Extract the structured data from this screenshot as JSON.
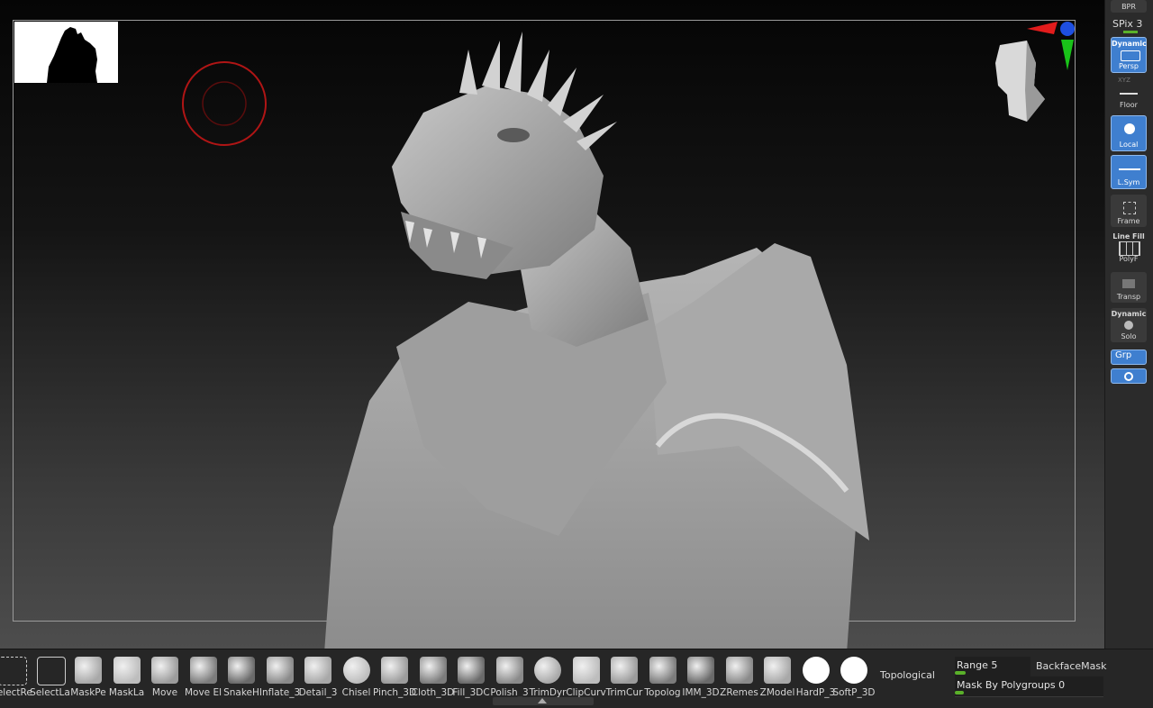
{
  "shelf": {
    "bpr": "BPR",
    "spix": "SPix 3",
    "dynamic": "Dynamic",
    "persp": "Persp",
    "xyz": "XYZ",
    "floor": "Floor",
    "local": "Local",
    "lsym": "L.Sym",
    "frame": "Frame",
    "linefill": "Line Fill",
    "polyf": "PolyF",
    "transp": "Transp",
    "dynamic2": "Dynamic",
    "solo": "Solo",
    "grp": "Grp"
  },
  "brushes": [
    {
      "name": "SelectRe",
      "icon": "select-rect-icon"
    },
    {
      "name": "SelectLa",
      "icon": "select-lasso-icon"
    },
    {
      "name": "MaskPe",
      "icon": "mask-pen-icon"
    },
    {
      "name": "MaskLa",
      "icon": "mask-lasso-icon"
    },
    {
      "name": "Move",
      "icon": "move-brush-icon"
    },
    {
      "name": "Move El",
      "icon": "move-elastic-icon"
    },
    {
      "name": "SnakeH",
      "icon": "snake-hook-icon"
    },
    {
      "name": "Inflate_3",
      "icon": "inflate-icon"
    },
    {
      "name": "Detail_3",
      "icon": "detail-icon"
    },
    {
      "name": "Chisel",
      "icon": "chisel-icon"
    },
    {
      "name": "Pinch_3D",
      "icon": "pinch-icon"
    },
    {
      "name": "Cloth_3D",
      "icon": "cloth-icon"
    },
    {
      "name": "Fill_3DC",
      "icon": "fill-icon"
    },
    {
      "name": "Polish_3",
      "icon": "polish-icon"
    },
    {
      "name": "TrimDyr",
      "icon": "trim-dynamic-icon"
    },
    {
      "name": "ClipCurv",
      "icon": "clip-curve-icon"
    },
    {
      "name": "TrimCur",
      "icon": "trim-curve-icon"
    },
    {
      "name": "Topolog",
      "icon": "topology-icon"
    },
    {
      "name": "IMM_3D",
      "icon": "imm-icon"
    },
    {
      "name": "ZRemes",
      "icon": "zremesh-icon"
    },
    {
      "name": "ZModel",
      "icon": "zmodeler-icon"
    },
    {
      "name": "HardP_3",
      "icon": "hard-polish-icon"
    },
    {
      "name": "SoftP_3D",
      "icon": "soft-polish-icon"
    }
  ],
  "tray": {
    "topological": "Topological",
    "range_label": "Range 5",
    "range_value": 0.1,
    "backface": "BackfaceMask",
    "mask_polygroups": "Mask By Polygroups 0",
    "mask_polygroups_value": 0
  },
  "colors": {
    "accent_blue": "#3f7fcf",
    "slider_green": "#5ab02a",
    "gizmo_red": "#e21c1c",
    "gizmo_green": "#19c219",
    "gizmo_blue": "#1e4fe0"
  }
}
